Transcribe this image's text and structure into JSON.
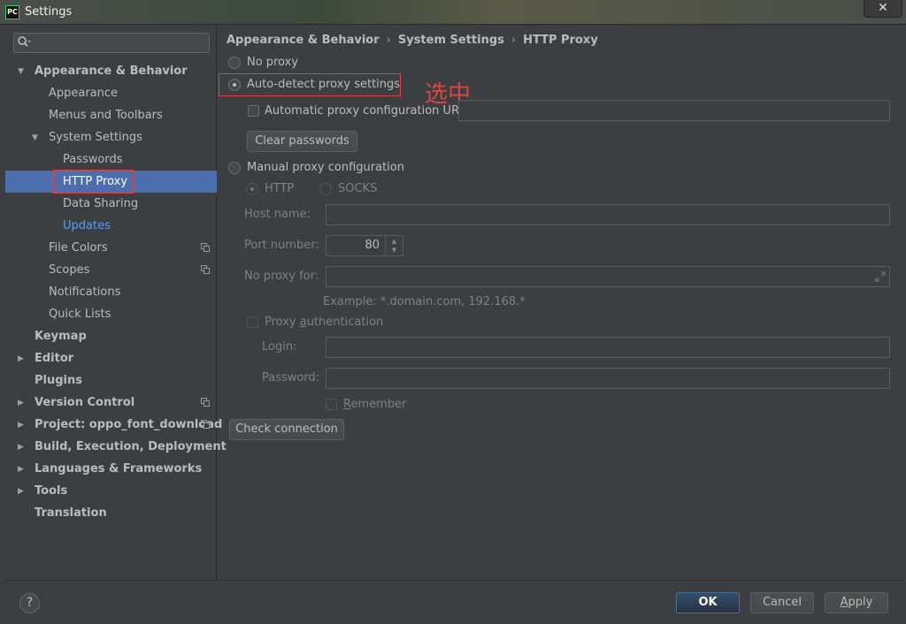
{
  "window": {
    "title": "Settings",
    "app_icon_text": "PC",
    "close_glyph": "✕"
  },
  "sidebar": {
    "search": {
      "placeholder": "",
      "value": ""
    },
    "items": [
      {
        "label": "Appearance & Behavior",
        "bold": true,
        "arrow": "expanded"
      },
      {
        "label": "Appearance"
      },
      {
        "label": "Menus and Toolbars"
      },
      {
        "label": "System Settings",
        "arrow": "expanded"
      },
      {
        "label": "Passwords"
      },
      {
        "label": "HTTP Proxy",
        "selected": true
      },
      {
        "label": "Data Sharing"
      },
      {
        "label": "Updates",
        "link": true
      },
      {
        "label": "File Colors",
        "copy_icon": true
      },
      {
        "label": "Scopes",
        "copy_icon": true
      },
      {
        "label": "Notifications"
      },
      {
        "label": "Quick Lists"
      },
      {
        "label": "Keymap",
        "bold": true
      },
      {
        "label": "Editor",
        "bold": true,
        "arrow": "collapsed"
      },
      {
        "label": "Plugins",
        "bold": true
      },
      {
        "label": "Version Control",
        "bold": true,
        "arrow": "collapsed",
        "copy_icon": true
      },
      {
        "label": "Project: oppo_font_download",
        "bold": true,
        "arrow": "collapsed",
        "copy_icon": true
      },
      {
        "label": "Build, Execution, Deployment",
        "bold": true,
        "arrow": "collapsed"
      },
      {
        "label": "Languages & Frameworks",
        "bold": true,
        "arrow": "collapsed"
      },
      {
        "label": "Tools",
        "bold": true,
        "arrow": "collapsed"
      },
      {
        "label": "Translation",
        "bold": true
      }
    ]
  },
  "breadcrumb": [
    "Appearance & Behavior",
    "System Settings",
    "HTTP Proxy"
  ],
  "breadcrumb_separator": "›",
  "proxy": {
    "no_proxy": {
      "label": "No proxy",
      "checked": false
    },
    "auto_detect": {
      "label": "Auto-detect proxy settings",
      "checked": true
    },
    "auto_config_url": {
      "label": "Automatic proxy configuration URL:",
      "value": ""
    },
    "clear_passwords": "Clear passwords",
    "manual": {
      "label": "Manual proxy configuration",
      "checked": false
    },
    "type_http": {
      "label": "HTTP",
      "checked": true
    },
    "type_socks": {
      "label": "SOCKS",
      "checked": false
    },
    "host_name": {
      "label": "Host name:",
      "value": ""
    },
    "port_number": {
      "label": "Port number:",
      "value": "80"
    },
    "no_proxy_for": {
      "label": "No proxy for:",
      "value": ""
    },
    "example": "Example: *.domain.com, 192.168.*",
    "proxy_auth": {
      "label_prefix": "Proxy ",
      "label_mnemonic": "a",
      "label_suffix": "uthentication"
    },
    "login": {
      "label": "Login:",
      "value": ""
    },
    "password": {
      "label": "Password:",
      "value": ""
    },
    "remember": {
      "label_mnemonic": "R",
      "label_suffix": "emember"
    },
    "check_connection": "Check connection"
  },
  "annotation": "选中",
  "buttons": {
    "help": "?",
    "ok": "OK",
    "cancel": "Cancel",
    "apply_mnemonic": "A",
    "apply_suffix": "pply"
  },
  "colors": {
    "background": "#3c3f41",
    "selection": "#4b6eaf",
    "link": "#589df6",
    "annotation_red": "#e0443e"
  }
}
